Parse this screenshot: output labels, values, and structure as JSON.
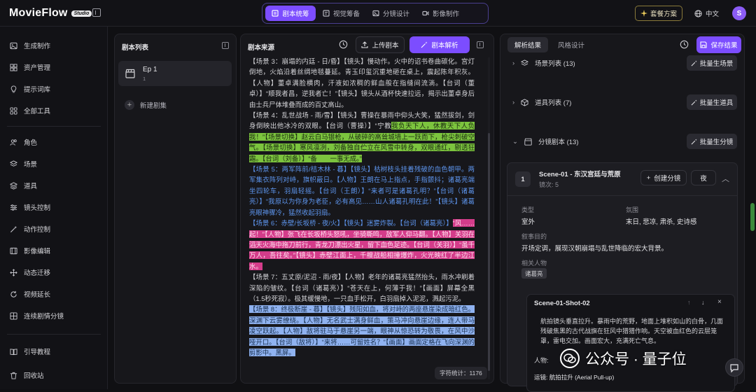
{
  "app": {
    "name": "MovieFlow",
    "badge": "Studio"
  },
  "top_tabs": [
    "剧本统筹",
    "视觉筹备",
    "分镜设计",
    "影像制作"
  ],
  "top_right": {
    "plan": "套餐方案",
    "language": "中文",
    "avatar": "S"
  },
  "sidebar": {
    "group1": [
      "生成制作",
      "资产管理",
      "提示词库",
      "全部工具"
    ],
    "group2": [
      "角色",
      "场景",
      "道具",
      "镜头控制",
      "动作控制",
      "影像编辑",
      "动态迁移",
      "视频延长",
      "连续剧情分镜"
    ],
    "group3": [
      "引导教程",
      "回收站"
    ]
  },
  "script_list": {
    "title": "剧本列表",
    "episode_title": "Ep 1",
    "episode_num": "1",
    "new_scene": "新建剧集"
  },
  "script_source": {
    "title": "剧本来源",
    "upload": "上传剧本",
    "parse": "剧本解析",
    "char_count": "字符统计：1176",
    "paragraphs": {
      "p1": "【场景 3：崩塌的内廷 - 日/昏】【镜头】慢动作。火中的诏书卷曲碳化。宫灯倒地，火焰沿着丝绸地毯蔓延。青玉印玺沉重地砸在桌上，震起陈年积灰。【人物】董卓满脸横肉，汗液如浓稠的鲜血般在指缝间流淌。【台词（董卓）】“顺我者昌，逆我者亡！”【镜头】镜头从酒杯快速拉远，揭示出董卓身后由士兵尸体堆叠而成的百丈高山。",
      "p2a": "【场景 4：乱世战场 - 雨/雪】【镜头】曹操在暴雨中仰头大笑，猛然拔剑，剑身倒映出他冰冷的双眼。【台词（曹操）】“宁教",
      "p2b": "我负天下人，休教天下人负我！”【场景切换】赵云白马银枪，从破碎的高耸城墙上一跃而下，枪尖刺破空气。【场景切换】寒风凛冽，刘备独自伫立在风雪中转身，双眼通红，剔透狂霜。【台词（刘备）】“备　　一事无成。”",
      "p3": "【场景 5：两军阵前/桔木林 - 暮】【镜头】枯树枝头挂着残破的血色朝甲。两军集衣阵列对峙，旗帜蔽日。【人物】王朗在马上指点，手指颤抖；诸葛亮端坐四轮车，羽扇轻摇。【台词（王朗）】“来者可是诸葛孔明？”【台词（诸葛亮）】“我原以为你身为老臣，必有高见……山人诸葛孔明在此！”【镜头】诸葛亮眼神骤冷，猛然收起羽扇。",
      "p4a": "【场景 6：赤壁/长坂桥 - 夜/火】【镜头】迷雾炸裂。【台词（诸葛亮）】",
      "p4b": "“风……起！”【人物】张飞在长坂桥头怒吼，坐骑嘶鸣，敌军人仰马翻。【人物】关羽在滔天火海中拖刀前行，青龙刀漂出火星，留下血色足迹。【台词（关羽）】“虽千万人，吾往矣。”【镜头】赤壁江面上，千艘战船相撞爆炸，火光映红了半边江水。",
      "p5": "【场景 7：五丈原/泥沼 - 雨/夜】【人物】老年的诸葛亮猛然抬头，雨水冲刷着深陷的皱纹。【台词（诸葛亮）】“苍天在上，何薄于我！”【画面】屏幕全黑（1.5秒死寂）。极其缓慢地，一只血手松开，白羽扇掉入泥泥，溅起污泥。",
      "p6": "【场景 8：终极断崖 - 暮】【镜头】残阳如血，将对峙的两座悬崖染成暗红色。深渊下云雾缭绕。【人物】无名武士满身鲜血，策马冲向悬崖边缘，连人带马凌空跃起。【人物】敌将驻马于悬崖另一端，眼神从惊恐转为敬畏，在风中沙哑开口。【台词（敌将）】“来将……可留姓名？”【画面】画面定格在飞向深渊的剪影中。黑屏。"
    }
  },
  "analysis": {
    "tabs": [
      "解析结果",
      "风格设计"
    ],
    "save": "保存结果",
    "sections": [
      {
        "label": "场景列表 (13)",
        "button": "批量生场景"
      },
      {
        "label": "道具列表 (7)",
        "button": "批量生道具"
      },
      {
        "label": "分镜剧本 (13)",
        "button": "批量生分镜"
      }
    ],
    "scene": {
      "number": "1",
      "title": "Scene-01 - 东汉宫廷与荒原",
      "subtitle": "镜次: 5",
      "create_btn": "创建分镜",
      "night_btn": "夜",
      "type_label": "类型",
      "type_value": "室外",
      "atmosphere_label": "氛围",
      "atmosphere_value": "末日, 悲凉, 肃杀, 史诗感",
      "purpose_label": "叙事目的",
      "purpose_value": "开场定调，展现汉朝崩塌与乱世降临的宏大背景。",
      "people_label": "相关人物",
      "people_tag": "诸葛亮"
    },
    "shot": {
      "title": "Scene-01-Shot-02",
      "description": "航拍镜头垂直拉升。暴雨中的荒野，地面上堆积如山的白骨，几面残破焦黑的古代战旗在狂风中猎猎作响。天空被血红色的云层笼罩，雷电交加。画面宏大，充满死亡气息。",
      "people_label": "人物:",
      "camera": "运镜: 航拍拉升 (Aerial Pull-up)"
    }
  },
  "watermark": "公众号 · 量子位"
}
